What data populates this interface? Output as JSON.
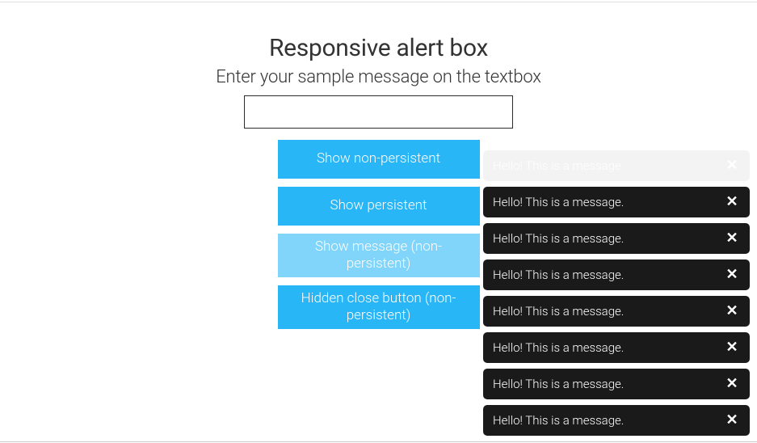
{
  "header": {
    "title": "Responsive alert box",
    "subtitle": "Enter your sample message on the textbox"
  },
  "input": {
    "value": ""
  },
  "buttons": [
    {
      "label": "Show non-persistent",
      "state": "normal"
    },
    {
      "label": "Show persistent",
      "state": "normal"
    },
    {
      "label": "Show message (non-persistent)",
      "state": "hovered"
    },
    {
      "label": "Hidden close button (non-persistent)",
      "state": "tall"
    }
  ],
  "toasts": [
    {
      "text": "Hello! This is a message.",
      "faded": true
    },
    {
      "text": "Hello! This is a message.",
      "faded": false
    },
    {
      "text": "Hello! This is a message.",
      "faded": false
    },
    {
      "text": "Hello! This is a message.",
      "faded": false
    },
    {
      "text": "Hello! This is a message.",
      "faded": false
    },
    {
      "text": "Hello! This is a message.",
      "faded": false
    },
    {
      "text": "Hello! This is a message.",
      "faded": false
    },
    {
      "text": "Hello! This is a message.",
      "faded": false
    }
  ],
  "close_symbol": "✕"
}
